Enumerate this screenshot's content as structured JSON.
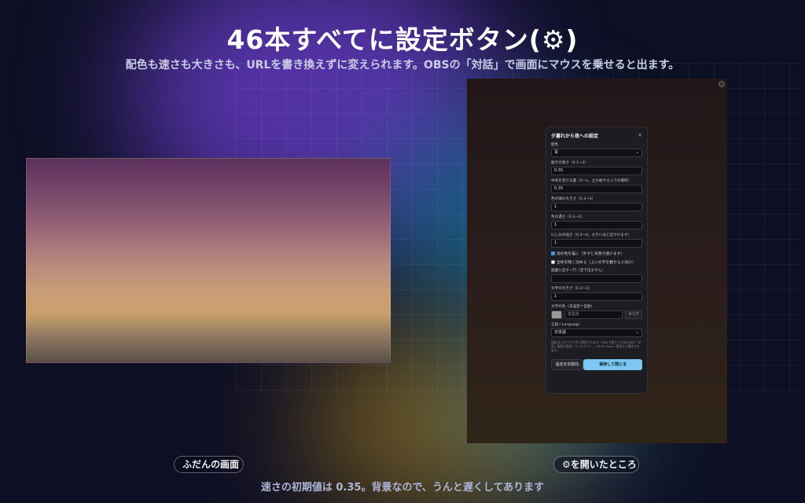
{
  "title": "46本すべてに設定ボタン(⚙)",
  "subtitle": "配色も速さも大きさも、URLを書き換えずに変えられます。OBSの「対話」で画面にマウスを乗せると出ます。",
  "captions": {
    "left": "ふだんの画面",
    "right": "⚙を開いたところ"
  },
  "footer": "速さの初期値は 0.35。背景なので、うんと遅くしてあります",
  "panel": {
    "title": "夕暮れから夜への設定",
    "close": "×",
    "palette": {
      "label": "配色",
      "value": "青",
      "caret": "⌄"
    },
    "speed": {
      "label": "動きの速さ（0.1〜3）",
      "value": "0.35"
    },
    "center_avoid": {
      "label": "中央を空ける量（0〜1。立ち絵やカメラの場所）",
      "value": "0.35"
    },
    "blob_size": {
      "label": "色の塊の大きさ（0.3〜3）",
      "value": "1"
    },
    "density": {
      "label": "色の濃さ（0.3〜2）",
      "value": "1"
    },
    "blur": {
      "label": "にじみの強さ（0.3〜4。大きいほどぼやけます）",
      "value": "1"
    },
    "draw_ground": {
      "label": "地の色を描く（外すと背景が透けます）",
      "checked": true
    },
    "darken": {
      "label": "全体を暗く沈める（上に文字を載せる人向け）",
      "checked": false
    },
    "text_line": {
      "label": "画面に出す一行（空で出ません）",
      "value": ""
    },
    "text_size": {
      "label": "文字の大きさ（0.3〜3）",
      "value": "1"
    },
    "text_color": {
      "label": "文字の色（未設定＝自動）",
      "placeholder": "未設定",
      "clear": "クリア",
      "swatch": "#9a9a9a"
    },
    "language": {
      "label": "言語 / Language",
      "value": "日本語",
      "caret": "⌄"
    },
    "note": "設定はこのブラウザに保存されます（OBSで使うときはOBSの「対話」画面で設定してください）。URLの ?xxx= 指定より優先されます。",
    "reset": "設定を初期化",
    "save": "保存して閉じる"
  },
  "colors": {
    "background": "#0d0f24",
    "accent": "#7cc7f2"
  }
}
